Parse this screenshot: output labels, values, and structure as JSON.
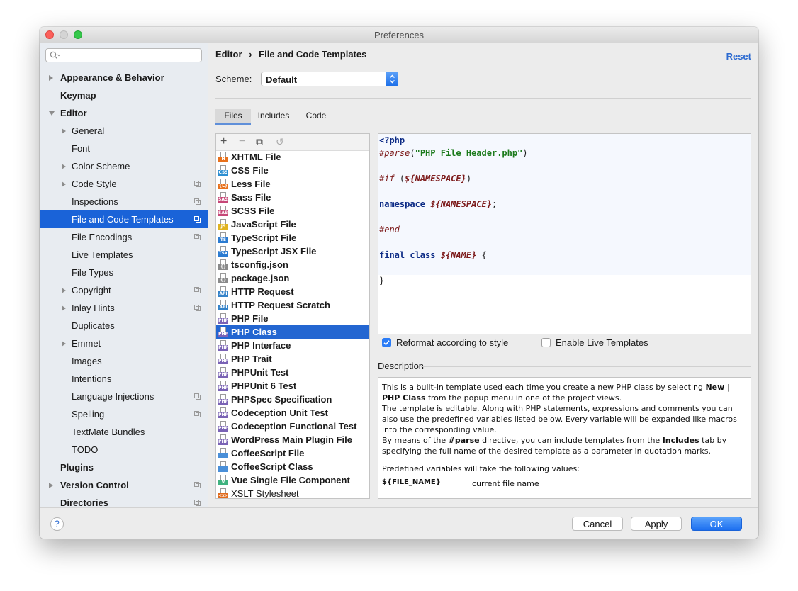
{
  "window": {
    "title": "Preferences"
  },
  "sidebar": {
    "items": [
      {
        "label": "Appearance & Behavior",
        "level": 0,
        "arrow": "right",
        "copy": false
      },
      {
        "label": "Keymap",
        "level": 0,
        "arrow": "none",
        "copy": false
      },
      {
        "label": "Editor",
        "level": 0,
        "arrow": "down",
        "copy": false
      },
      {
        "label": "General",
        "level": 1,
        "arrow": "right",
        "copy": false
      },
      {
        "label": "Font",
        "level": 1,
        "arrow": "none",
        "copy": false
      },
      {
        "label": "Color Scheme",
        "level": 1,
        "arrow": "right",
        "copy": false
      },
      {
        "label": "Code Style",
        "level": 1,
        "arrow": "right",
        "copy": true
      },
      {
        "label": "Inspections",
        "level": 1,
        "arrow": "none",
        "copy": true
      },
      {
        "label": "File and Code Templates",
        "level": 1,
        "arrow": "none",
        "copy": true,
        "selected": true
      },
      {
        "label": "File Encodings",
        "level": 1,
        "arrow": "none",
        "copy": true
      },
      {
        "label": "Live Templates",
        "level": 1,
        "arrow": "none",
        "copy": false
      },
      {
        "label": "File Types",
        "level": 1,
        "arrow": "none",
        "copy": false
      },
      {
        "label": "Copyright",
        "level": 1,
        "arrow": "right",
        "copy": true
      },
      {
        "label": "Inlay Hints",
        "level": 1,
        "arrow": "right",
        "copy": true
      },
      {
        "label": "Duplicates",
        "level": 1,
        "arrow": "none",
        "copy": false
      },
      {
        "label": "Emmet",
        "level": 1,
        "arrow": "right",
        "copy": false
      },
      {
        "label": "Images",
        "level": 1,
        "arrow": "none",
        "copy": false
      },
      {
        "label": "Intentions",
        "level": 1,
        "arrow": "none",
        "copy": false
      },
      {
        "label": "Language Injections",
        "level": 1,
        "arrow": "none",
        "copy": true
      },
      {
        "label": "Spelling",
        "level": 1,
        "arrow": "none",
        "copy": true
      },
      {
        "label": "TextMate Bundles",
        "level": 1,
        "arrow": "none",
        "copy": false
      },
      {
        "label": "TODO",
        "level": 1,
        "arrow": "none",
        "copy": false
      },
      {
        "label": "Plugins",
        "level": 0,
        "arrow": "none",
        "copy": false
      },
      {
        "label": "Version Control",
        "level": 0,
        "arrow": "right",
        "copy": true
      },
      {
        "label": "Directories",
        "level": 0,
        "arrow": "none",
        "copy": true
      }
    ]
  },
  "header": {
    "breadcrumb_root": "Editor",
    "breadcrumb_sep": "›",
    "breadcrumb_leaf": "File and Code Templates",
    "reset": "Reset"
  },
  "scheme": {
    "label": "Scheme:",
    "value": "Default"
  },
  "tabs": [
    "Files",
    "Includes",
    "Code"
  ],
  "toolbar": {
    "add": "+",
    "remove": "−",
    "copy": "⧉",
    "reset": "↺"
  },
  "files": [
    {
      "name": "XHTML File",
      "tag": "H",
      "color": "#e8711c"
    },
    {
      "name": "CSS File",
      "tag": "CSS",
      "color": "#2c8ed1"
    },
    {
      "name": "Less File",
      "tag": "{L}",
      "color": "#e8711c"
    },
    {
      "name": "Sass File",
      "tag": "SASS",
      "color": "#c64777"
    },
    {
      "name": "SCSS File",
      "tag": "SASS",
      "color": "#c64777"
    },
    {
      "name": "JavaScript File",
      "tag": "JS",
      "color": "#e0b320"
    },
    {
      "name": "TypeScript File",
      "tag": "TS",
      "color": "#2b7bd1"
    },
    {
      "name": "TypeScript JSX File",
      "tag": "TSX",
      "color": "#2b7bd1"
    },
    {
      "name": "tsconfig.json",
      "tag": "{}",
      "color": "#8a8a8a"
    },
    {
      "name": "package.json",
      "tag": "{}",
      "color": "#8a8a8a"
    },
    {
      "name": "HTTP Request",
      "tag": "API",
      "color": "#3583c9"
    },
    {
      "name": "HTTP Request Scratch",
      "tag": "API",
      "color": "#3583c9"
    },
    {
      "name": "PHP File",
      "tag": "PHP",
      "color": "#7a63b5"
    },
    {
      "name": "PHP Class",
      "tag": "PHP",
      "color": "#7a63b5",
      "selected": true
    },
    {
      "name": "PHP Interface",
      "tag": "PHP",
      "color": "#7a63b5"
    },
    {
      "name": "PHP Trait",
      "tag": "PHP",
      "color": "#7a63b5"
    },
    {
      "name": "PHPUnit Test",
      "tag": "PHP",
      "color": "#7a63b5"
    },
    {
      "name": "PHPUnit 6 Test",
      "tag": "PHP",
      "color": "#7a63b5"
    },
    {
      "name": "PHPSpec Specification",
      "tag": "PHP",
      "color": "#7a63b5"
    },
    {
      "name": "Codeception Unit Test",
      "tag": "PHP",
      "color": "#7a63b5"
    },
    {
      "name": "Codeception Functional Test",
      "tag": "PHP",
      "color": "#7a63b5"
    },
    {
      "name": "WordPress Main Plugin File",
      "tag": "PHP",
      "color": "#7a63b5"
    },
    {
      "name": "CoffeeScript File",
      "tag": "",
      "color": "#4a8fd8"
    },
    {
      "name": "CoffeeScript Class",
      "tag": "",
      "color": "#4a8fd8"
    },
    {
      "name": "Vue Single File Component",
      "tag": "V",
      "color": "#3fb27f"
    },
    {
      "name": "XSLT Stylesheet",
      "tag": "<x>",
      "color": "#e06a1b",
      "plain": true
    }
  ],
  "code_lines": [
    [
      {
        "t": "<?php",
        "c": "kw"
      }
    ],
    [
      {
        "t": "#parse",
        "c": "it"
      },
      {
        "t": "(",
        "c": ""
      },
      {
        "t": "\"PHP File Header.php\"",
        "c": "str"
      },
      {
        "t": ")",
        "c": ""
      }
    ],
    [],
    [
      {
        "t": "#if",
        "c": "it"
      },
      {
        "t": " (",
        "c": ""
      },
      {
        "t": "${NAMESPACE}",
        "c": "vr"
      },
      {
        "t": ")",
        "c": ""
      }
    ],
    [],
    [
      {
        "t": "namespace",
        "c": "kw"
      },
      {
        "t": " ",
        "c": ""
      },
      {
        "t": "${NAMESPACE}",
        "c": "vr"
      },
      {
        "t": ";",
        "c": ""
      }
    ],
    [],
    [
      {
        "t": "#end",
        "c": "it"
      }
    ],
    [],
    [
      {
        "t": "final class",
        "c": "kw"
      },
      {
        "t": " ",
        "c": ""
      },
      {
        "t": "${NAME}",
        "c": "vr"
      },
      {
        "t": " {",
        "c": ""
      }
    ],
    [],
    [
      {
        "t": "}",
        "c": ""
      }
    ]
  ],
  "options": {
    "reformat": "Reformat according to style",
    "reformat_checked": true,
    "live": "Enable Live Templates",
    "live_checked": false
  },
  "description": {
    "label": "Description",
    "p1a": "This is a built-in template used each time you create a new PHP class by selecting ",
    "p1b": "New | PHP Class",
    "p1c": " from the popup menu in one of the project views.",
    "p2": "The template is editable. Along with PHP statements, expressions and comments you can also use the predefined variables listed below. Every variable will be expanded like macros into the corresponding value.",
    "p3a": "By means of the ",
    "p3b": "#parse",
    "p3c": " directive, you can include templates from the ",
    "p3d": "Includes",
    "p3e": " tab by specifying the full name of the desired template as a parameter in quotation marks.",
    "p4": "Predefined variables will take the following values:",
    "var_name": "${FILE_NAME}",
    "var_desc": "current file name"
  },
  "buttons": {
    "help": "?",
    "cancel": "Cancel",
    "apply": "Apply",
    "ok": "OK"
  }
}
